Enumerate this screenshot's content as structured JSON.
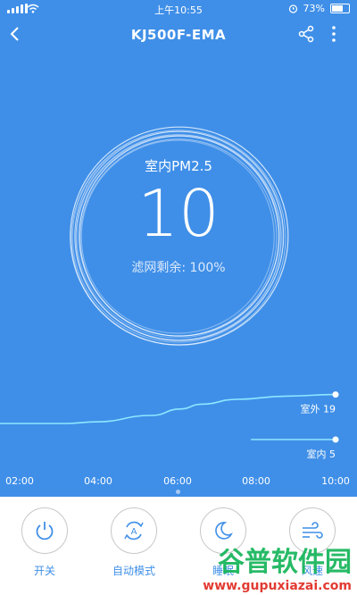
{
  "status": {
    "time": "上午10:55",
    "battery": "73%",
    "battery_level": 0.73
  },
  "nav": {
    "title": "KJ500F-EMA"
  },
  "indoor": {
    "label": "室内PM2.5",
    "value": "10",
    "filter_text": "滤网剩余: 100%"
  },
  "chart_data": {
    "type": "line",
    "categories": [
      "02:00",
      "04:00",
      "06:00",
      "08:00",
      "10:00"
    ],
    "series": [
      {
        "name": "室外",
        "end_label": "室外 19",
        "color": "#8fe6ff",
        "points": [
          [
            1.0,
            10
          ],
          [
            2.4,
            10
          ],
          [
            3.2,
            10.5
          ],
          [
            4.8,
            12.5
          ],
          [
            5.6,
            14.5
          ],
          [
            6.2,
            16
          ],
          [
            7.2,
            17.5
          ],
          [
            8.6,
            18.5
          ],
          [
            10.0,
            19
          ]
        ]
      },
      {
        "name": "室内",
        "end_label": "室内 5",
        "color": "#8fe6ff",
        "points": [
          [
            7.6,
            5
          ],
          [
            10.0,
            5
          ]
        ]
      }
    ],
    "xlim": [
      1.0,
      10.0
    ],
    "ylim": [
      0,
      25
    ],
    "grid": false
  },
  "controls": [
    {
      "label": "开关",
      "icon": "power-icon"
    },
    {
      "label": "自动模式",
      "icon": "auto-mode-icon"
    },
    {
      "label": "睡眠",
      "icon": "moon-icon"
    },
    {
      "label": "风速",
      "icon": "wind-icon"
    }
  ],
  "watermark": {
    "brand": "谷普软件园",
    "url": "www.gupuxiazai.com"
  }
}
